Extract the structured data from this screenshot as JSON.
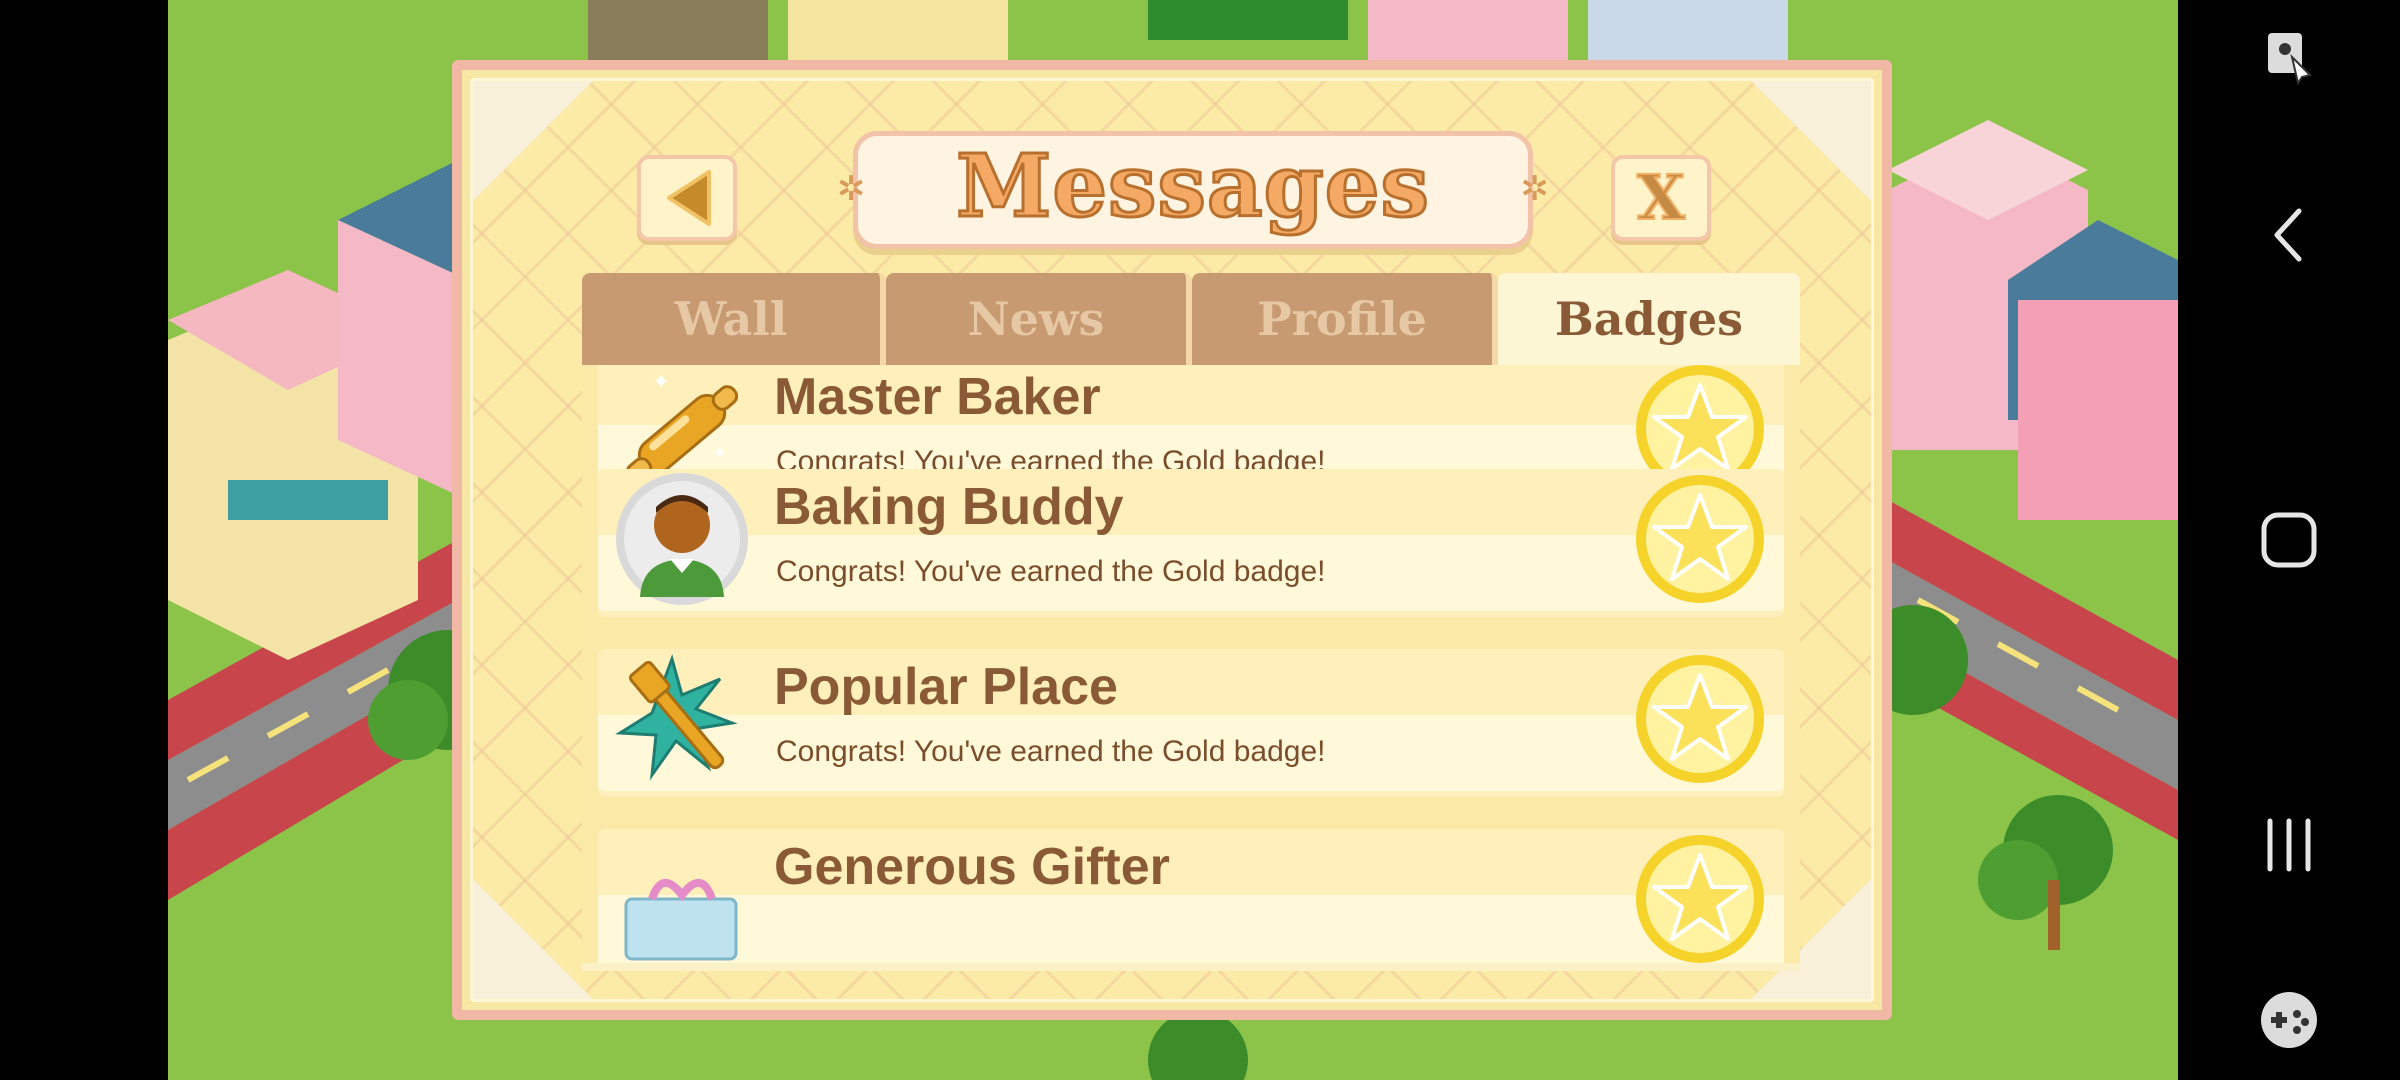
{
  "dialog": {
    "title": "Messages",
    "close_label": "X"
  },
  "tabs": [
    {
      "label": "Wall",
      "active": false
    },
    {
      "label": "News",
      "active": false
    },
    {
      "label": "Profile",
      "active": false
    },
    {
      "label": "Badges",
      "active": true
    }
  ],
  "badges": [
    {
      "name": "Master Baker",
      "description": "Congrats! You've earned the Gold badge!",
      "icon": "rolling-pin-icon"
    },
    {
      "name": "Baking Buddy",
      "description": "Congrats! You've earned the Gold badge!",
      "icon": "person-icon"
    },
    {
      "name": "Popular Place",
      "description": "Congrats! You've earned the Gold badge!",
      "icon": "fork-star-icon"
    },
    {
      "name": "Generous Gifter",
      "description": "",
      "icon": "gift-icon"
    }
  ],
  "colors": {
    "dialog_bg": "#fbeba6",
    "dialog_border": "#f2b8a6",
    "tab_inactive": "#c89a72",
    "tab_active": "#fdf6d4",
    "text_brown": "#8a5a36",
    "gold": "#f6d32b"
  }
}
